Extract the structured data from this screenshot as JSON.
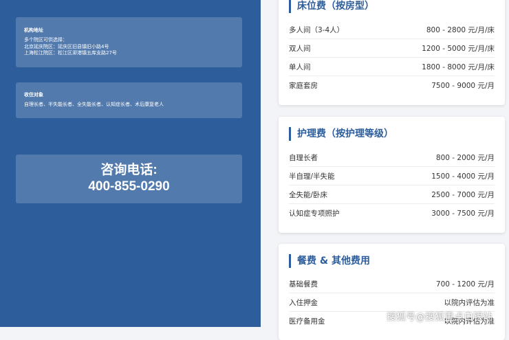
{
  "left": {
    "address": {
      "title": "机构地址",
      "lines": [
        "多个院区可供选择：",
        "北京延庆院区：延庆区旧县镇旧小路4号",
        "上海松江院区：松江区泖港镇五库支路27号"
      ]
    },
    "residents": {
      "title": "收住对象",
      "text": "自理长者、半失能长者、全失能长者、认知症长者、术后康复老人"
    },
    "phone": {
      "label": "咨询电话:",
      "number": "400-855-0290"
    }
  },
  "panels": [
    {
      "title": "床位费（按房型）",
      "rows": [
        {
          "name": "多人间（3-4人）",
          "price": "800 - 2800 元/月/床"
        },
        {
          "name": "双人间",
          "price": "1200 - 5000 元/月/床"
        },
        {
          "name": "单人间",
          "price": "1800 - 8000 元/月/床"
        },
        {
          "name": "家庭套房",
          "price": "7500 - 9000 元/月"
        }
      ]
    },
    {
      "title": "护理费（按护理等级）",
      "rows": [
        {
          "name": "自理长者",
          "price": "800 - 2000 元/月"
        },
        {
          "name": "半自理/半失能",
          "price": "1500 - 4000 元/月"
        },
        {
          "name": "全失能/卧床",
          "price": "2500 - 7000 元/月"
        },
        {
          "name": "认知症专项照护",
          "price": "3000 - 7500 元/月"
        }
      ]
    },
    {
      "title": "餐费 & 其他费用",
      "rows": [
        {
          "name": "基础餐费",
          "price": "700 - 1200 元/月"
        },
        {
          "name": "入住押金",
          "price": "以院内评估为准"
        },
        {
          "name": "医疗备用金",
          "price": "以院内评估为准"
        }
      ]
    }
  ],
  "watermark": "搜狐号@搜狐重点白银站"
}
